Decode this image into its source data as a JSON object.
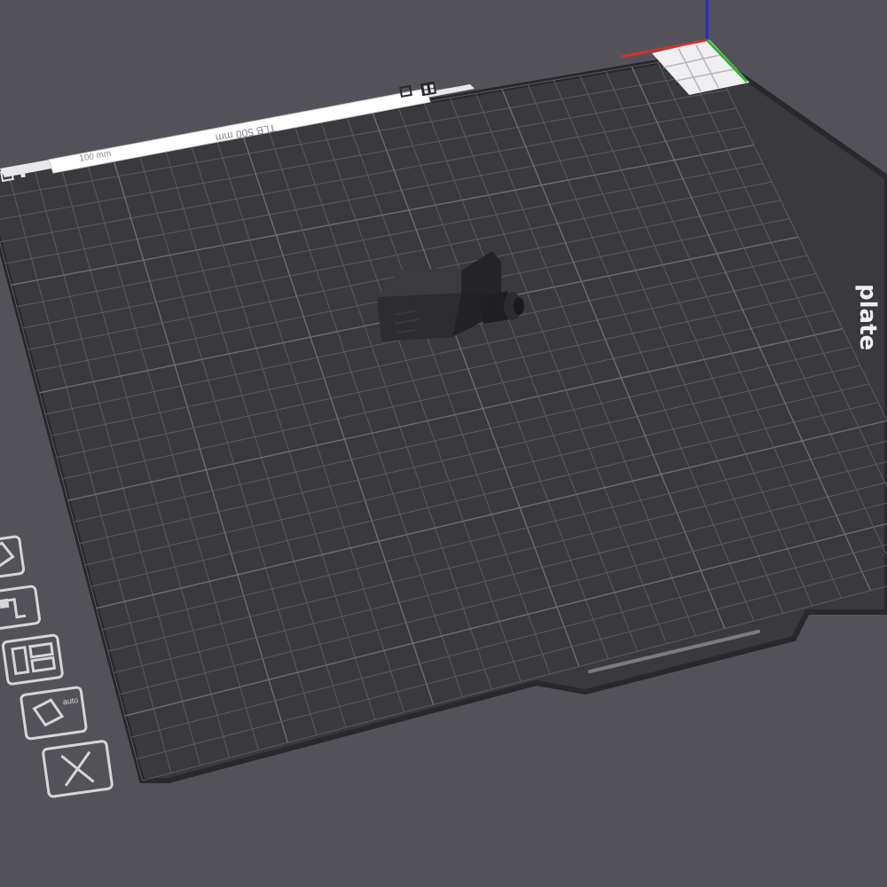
{
  "app": {
    "view": "3D viewport",
    "background_color": "#535259",
    "plate_color": "#3a393e",
    "plate_edge_color": "#29282c",
    "grid_color": "#5c5b61",
    "grid_major_color": "#6e6d73"
  },
  "build_plate": {
    "brand_text": "plate",
    "top_label_text": "TLB 500 mm",
    "top_label_secondary": "100 mm",
    "handle_slot": "handle-slot"
  },
  "plate_icons": {
    "top_left_icons": [
      "plate-settings-icon",
      "thermometer-icon"
    ],
    "top_right_icons": [
      "plate-lock-icon",
      "plate-layout-icon"
    ],
    "side_icons": [
      {
        "name": "orient-icon"
      },
      {
        "name": "filament-icon"
      },
      {
        "name": "arrange-icon"
      },
      {
        "name": "auto-orient-icon",
        "label": "auto"
      },
      {
        "name": "delete-plate-icon"
      }
    ]
  },
  "axes": {
    "x_color": "#d0302c",
    "y_color": "#28b428",
    "z_color": "#2a2ad6"
  },
  "model": {
    "name": "printed-part-model",
    "color": "#2a2a2c"
  }
}
